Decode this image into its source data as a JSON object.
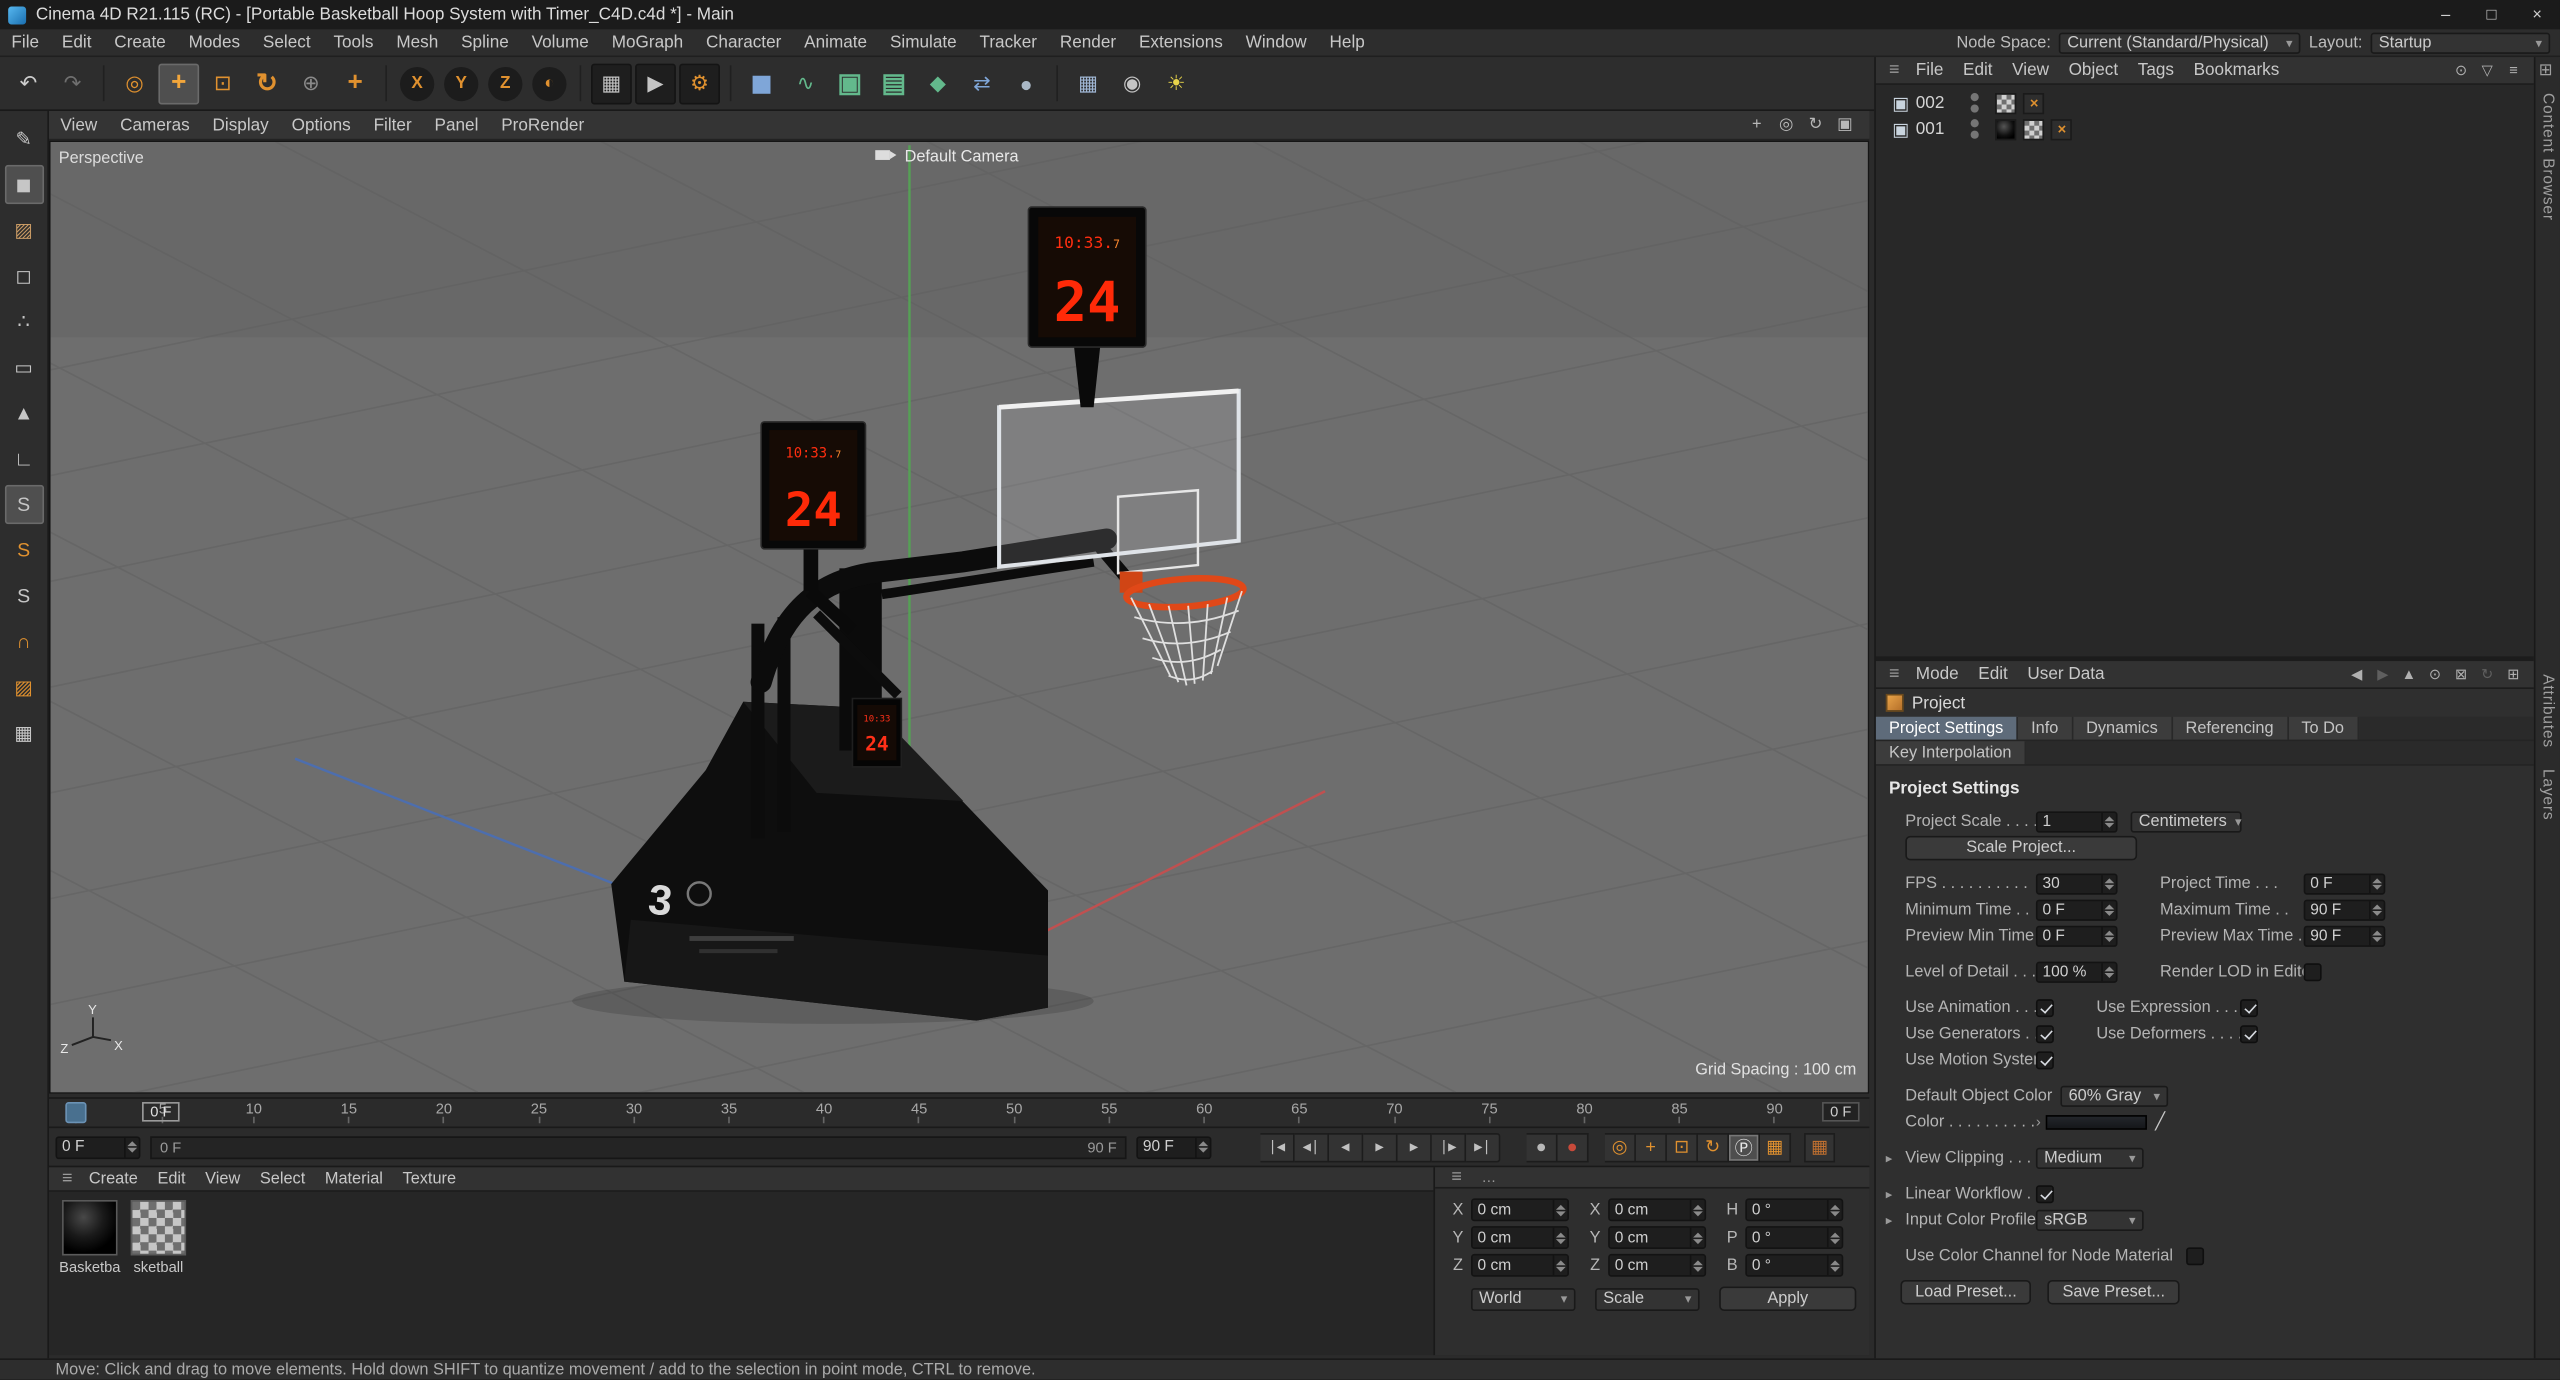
{
  "window": {
    "title": "Cinema 4D R21.115 (RC) - [Portable Basketball Hoop System with Timer_C4D.c4d *] - Main",
    "minimize": "–",
    "maximize": "□",
    "close": "×"
  },
  "menubar": {
    "items": [
      "File",
      "Edit",
      "Create",
      "Modes",
      "Select",
      "Tools",
      "Mesh",
      "Spline",
      "Volume",
      "MoGraph",
      "Character",
      "Animate",
      "Simulate",
      "Tracker",
      "Render",
      "Extensions",
      "Window",
      "Help"
    ],
    "node_space_label": "Node Space:",
    "node_space_value": "Current (Standard/Physical)",
    "layout_label": "Layout:",
    "layout_value": "Startup"
  },
  "colors": {
    "accent_orange": "#e0912f",
    "selection_blue_gray": "#5e6b7a",
    "led_red": "#ff2e10",
    "led_orange": "#ff8a30",
    "rim_orange": "#e04818",
    "record_red": "#c84a3a"
  },
  "toolbar": {
    "icons": [
      {
        "name": "undo-icon",
        "glyph": "↶",
        "fg": "#cccccc"
      },
      {
        "name": "redo-icon",
        "glyph": "↷",
        "fg": "#6f6f6f"
      },
      {
        "name": "toolbar-separator",
        "cls": "sep"
      },
      {
        "name": "live-selection-tool",
        "glyph": "◎",
        "fg": "#e0912f"
      },
      {
        "name": "move-tool",
        "glyph": "+",
        "fg": "#f2a63b",
        "cls": "sel big"
      },
      {
        "name": "scale-tool",
        "glyph": "⊡",
        "fg": "#e0912f"
      },
      {
        "name": "rotate-tool",
        "glyph": "↻",
        "fg": "#e0912f",
        "cls": "big"
      },
      {
        "name": "last-used-tool",
        "glyph": "⊕",
        "fg": "#8a8a8a"
      },
      {
        "name": "axis-modification-tool",
        "glyph": "+",
        "fg": "#e0912f",
        "cls": "big"
      },
      {
        "name": "toolbar-separator",
        "cls": "sep"
      },
      {
        "name": "lock-x-axis-button",
        "glyph": "X",
        "fg": "#e0912f",
        "cls": "round"
      },
      {
        "name": "lock-y-axis-button",
        "glyph": "Y",
        "fg": "#e0912f",
        "cls": "round"
      },
      {
        "name": "lock-z-axis-button",
        "glyph": "Z",
        "fg": "#e0912f",
        "cls": "round"
      },
      {
        "name": "coordinate-system-button",
        "glyph": "◐",
        "fg": "#e0912f",
        "cls": "round"
      },
      {
        "name": "toolbar-separator",
        "cls": "sep"
      },
      {
        "name": "render-view-button",
        "glyph": "▦",
        "fg": "#c4c4c4",
        "cls": "dark"
      },
      {
        "name": "render-picture-viewer-button",
        "glyph": "▶",
        "fg": "#c4c4c4",
        "cls": "dark"
      },
      {
        "name": "render-settings-button",
        "glyph": "⚙",
        "fg": "#e0912f",
        "cls": "dark"
      },
      {
        "name": "toolbar-separator",
        "cls": "sep"
      },
      {
        "name": "cube-primitive-button",
        "glyph": "◼",
        "fg": "#7fa6d8",
        "cls": "big"
      },
      {
        "name": "spline-pen-button",
        "glyph": "∿",
        "fg": "#63b98c"
      },
      {
        "name": "subdivision-surface-button",
        "glyph": "▣",
        "fg": "#63b98c",
        "cls": "big"
      },
      {
        "name": "volume-builder-button",
        "glyph": "▤",
        "fg": "#63b98c",
        "cls": "big"
      },
      {
        "name": "mograph-cloner-button",
        "glyph": "◆",
        "fg": "#63b98c"
      },
      {
        "name": "array-tool-button",
        "glyph": "⇄",
        "fg": "#7fa6d8"
      },
      {
        "name": "simulate-button",
        "glyph": "●",
        "fg": "#aab8c6"
      },
      {
        "name": "toolbar-separator",
        "cls": "sep"
      },
      {
        "name": "floor-object-button",
        "glyph": "▦",
        "fg": "#9fb6d4"
      },
      {
        "name": "camera-object-button",
        "glyph": "◉",
        "fg": "#c4c4c4"
      },
      {
        "name": "light-object-button",
        "glyph": "☀",
        "fg": "#e8d44a"
      }
    ]
  },
  "left_toolbar": {
    "icons": [
      {
        "name": "make-editable-button",
        "glyph": "✎"
      },
      {
        "name": "model-mode-button",
        "glyph": "◼",
        "cls": "sel"
      },
      {
        "name": "texture-mode-button",
        "glyph": "▨",
        "fg": "#c89a64"
      },
      {
        "name": "workplane-mode-button",
        "glyph": "◻"
      },
      {
        "name": "points-mode-button",
        "glyph": "∴"
      },
      {
        "name": "edges-mode-button",
        "glyph": "▭"
      },
      {
        "name": "polygons-mode-button",
        "glyph": "▲"
      },
      {
        "name": "axis-workplane-button",
        "glyph": "∟"
      },
      {
        "name": "viewport-solo-off-button",
        "glyph": "S",
        "cls": "sel"
      },
      {
        "name": "viewport-solo-single-button",
        "glyph": "S",
        "fg": "#e0912f"
      },
      {
        "name": "viewport-solo-hierarchy-button",
        "glyph": "S"
      },
      {
        "name": "enable-snap-button",
        "glyph": "∩",
        "fg": "#e0912f"
      },
      {
        "name": "snap-settings-button",
        "glyph": "▨",
        "fg": "#e0912f"
      },
      {
        "name": "quantize-button",
        "glyph": "▦"
      }
    ]
  },
  "viewport": {
    "menu": [
      "View",
      "Cameras",
      "Display",
      "Options",
      "Filter",
      "Panel",
      "ProRender"
    ],
    "view_icons": [
      {
        "name": "pan-view-icon",
        "glyph": "+"
      },
      {
        "name": "zoom-view-icon",
        "glyph": "◎"
      },
      {
        "name": "rotate-view-icon",
        "glyph": "↻"
      },
      {
        "name": "toggle-views-icon",
        "glyph": "▣"
      }
    ],
    "view_label": "Perspective",
    "camera_label": "Default Camera",
    "grid_spacing": "Grid Spacing : 100 cm",
    "axis": {
      "x": "X",
      "y": "Y",
      "z": "Z"
    },
    "base_logo": "3",
    "shot_clock": {
      "time": "10:33.",
      "frac": "7",
      "seconds": "24",
      "time_small": "10:33"
    }
  },
  "timeline": {
    "ticks": [
      "0",
      "5",
      "10",
      "15",
      "20",
      "25",
      "30",
      "35",
      "40",
      "45",
      "50",
      "55",
      "60",
      "65",
      "70",
      "75",
      "80",
      "85",
      "90"
    ],
    "playhead_label": "0 F",
    "current_field": "0 F"
  },
  "transport": {
    "current": "0 F",
    "range_start": "0 F",
    "range_end": "90 F",
    "max": "90 F",
    "buttons": [
      {
        "name": "goto-start-button",
        "glyph": "|◀"
      },
      {
        "name": "prev-key-button",
        "glyph": "◀|"
      },
      {
        "name": "prev-frame-button",
        "glyph": "◀"
      },
      {
        "name": "play-button",
        "glyph": "▶"
      },
      {
        "name": "next-frame-button",
        "glyph": "▶"
      },
      {
        "name": "next-key-button",
        "glyph": "|▶"
      },
      {
        "name": "goto-end-button",
        "glyph": "▶|"
      }
    ],
    "records": [
      {
        "name": "record-objects-button",
        "glyph": "●",
        "fg": "#b8b8b8"
      },
      {
        "name": "record-keyframe-button",
        "glyph": "●",
        "fg": "#c84a3a"
      }
    ],
    "keys": [
      {
        "name": "keying-settings-button",
        "glyph": "◎",
        "fg": "#e0912f"
      },
      {
        "name": "key-position-toggle",
        "glyph": "+",
        "fg": "#e0912f"
      },
      {
        "name": "key-scale-toggle",
        "glyph": "⊡",
        "fg": "#e0912f"
      },
      {
        "name": "key-rotation-toggle",
        "glyph": "↻",
        "fg": "#e0912f"
      },
      {
        "name": "key-parameter-toggle",
        "glyph": "Ⓟ",
        "fg": "#e6e6e6",
        "cls": "on"
      },
      {
        "name": "key-point-level-toggle",
        "glyph": "▦",
        "fg": "#e0912f"
      }
    ],
    "autokey_glyph": "▦"
  },
  "materials": {
    "menu": [
      "Create",
      "Edit",
      "View",
      "Select",
      "Material",
      "Texture"
    ],
    "items": [
      {
        "name": "Basketba"
      },
      {
        "name": "sketball"
      }
    ]
  },
  "coords": {
    "rows": [
      {
        "l1": "X",
        "v1": "0 cm",
        "l2": "X",
        "v2": "0 cm",
        "l3": "H",
        "v3": "0 °"
      },
      {
        "l1": "Y",
        "v1": "0 cm",
        "l2": "Y",
        "v2": "0 cm",
        "l3": "P",
        "v3": "0 °"
      },
      {
        "l1": "Z",
        "v1": "0 cm",
        "l2": "Z",
        "v2": "0 cm",
        "l3": "B",
        "v3": "0 °"
      }
    ],
    "space": "World",
    "mode": "Scale",
    "apply": "Apply"
  },
  "object_manager": {
    "menu": [
      "File",
      "Edit",
      "View",
      "Object",
      "Tags",
      "Bookmarks"
    ],
    "icons": [
      {
        "name": "search-icon",
        "glyph": "⊙"
      },
      {
        "name": "filter-icon",
        "glyph": "▽"
      },
      {
        "name": "view-options-icon",
        "glyph": "≡"
      }
    ],
    "objects": [
      {
        "name": "002"
      },
      {
        "name": "001"
      }
    ]
  },
  "attributes": {
    "menu": [
      "Mode",
      "Edit",
      "User Data"
    ],
    "icons": [
      {
        "name": "back-icon",
        "glyph": "◀"
      },
      {
        "name": "forward-icon",
        "glyph": "▶",
        "cls": "dim"
      },
      {
        "name": "up-icon",
        "glyph": "▲"
      },
      {
        "name": "search-icon",
        "glyph": "⊙"
      },
      {
        "name": "lock-icon",
        "glyph": "⊠"
      },
      {
        "name": "history-icon",
        "glyph": "↻",
        "cls": "dim"
      },
      {
        "name": "new-panel-icon",
        "glyph": "⊞"
      }
    ],
    "object_label": "Project",
    "tabs": [
      {
        "label": "Project Settings",
        "cls": "sel"
      },
      {
        "label": "Info"
      },
      {
        "label": "Dynamics"
      },
      {
        "label": "Referencing"
      },
      {
        "label": "To Do"
      }
    ],
    "tabs_row2": [
      {
        "label": "Key Interpolation"
      }
    ],
    "section_title": "Project Settings",
    "project_scale": {
      "label": "Project Scale . . . . .",
      "value": "1",
      "unit": "Centimeters"
    },
    "scale_project_button": "Scale Project...",
    "fps": {
      "label": "FPS . . . . . . . . . .",
      "value": "30"
    },
    "project_time": {
      "label": "Project Time . . .",
      "value": "0 F"
    },
    "minimum_time": {
      "label": "Minimum Time . .",
      "value": "0 F"
    },
    "maximum_time": {
      "label": "Maximum Time . .",
      "value": "90 F"
    },
    "preview_min_time": {
      "label": "Preview Min Time . .",
      "value": "0 F"
    },
    "preview_max_time": {
      "label": "Preview Max Time . .",
      "value": "90 F"
    },
    "level_of_detail": {
      "label": "Level of Detail . . . . .",
      "value": "100 %"
    },
    "render_lod": {
      "label": "Render LOD in Editor",
      "checked": false
    },
    "use_animation": {
      "label": "Use Animation . . . . .",
      "checked": true
    },
    "use_expression": {
      "label": "Use Expression . . . .",
      "checked": true
    },
    "use_generators": {
      "label": "Use Generators . . . .",
      "checked": true
    },
    "use_deformers": {
      "label": "Use Deformers . . . .",
      "checked": true
    },
    "use_motion_system": {
      "label": "Use Motion System",
      "checked": true
    },
    "default_object_color": {
      "label": "Default Object Color",
      "value": "60% Gray"
    },
    "color": {
      "label": "Color . . . . . . . . . . . ."
    },
    "view_clipping": {
      "label": "View Clipping . . . . . .",
      "value": "Medium"
    },
    "linear_workflow": {
      "label": "Linear Workflow . . .",
      "checked": true
    },
    "input_color_profile": {
      "label": "Input Color Profile . .",
      "value": "sRGB"
    },
    "use_color_channel": {
      "label": "Use Color Channel for Node Material",
      "checked": false
    },
    "load_preset_button": "Load Preset...",
    "save_preset_button": "Save Preset..."
  },
  "right_strip": {
    "tabs": [
      "Content Browser",
      "Attributes",
      "Layers"
    ]
  },
  "statusbar": {
    "text": "Move: Click and drag to move elements. Hold down SHIFT to quantize movement / add to the selection in point mode, CTRL to remove."
  }
}
